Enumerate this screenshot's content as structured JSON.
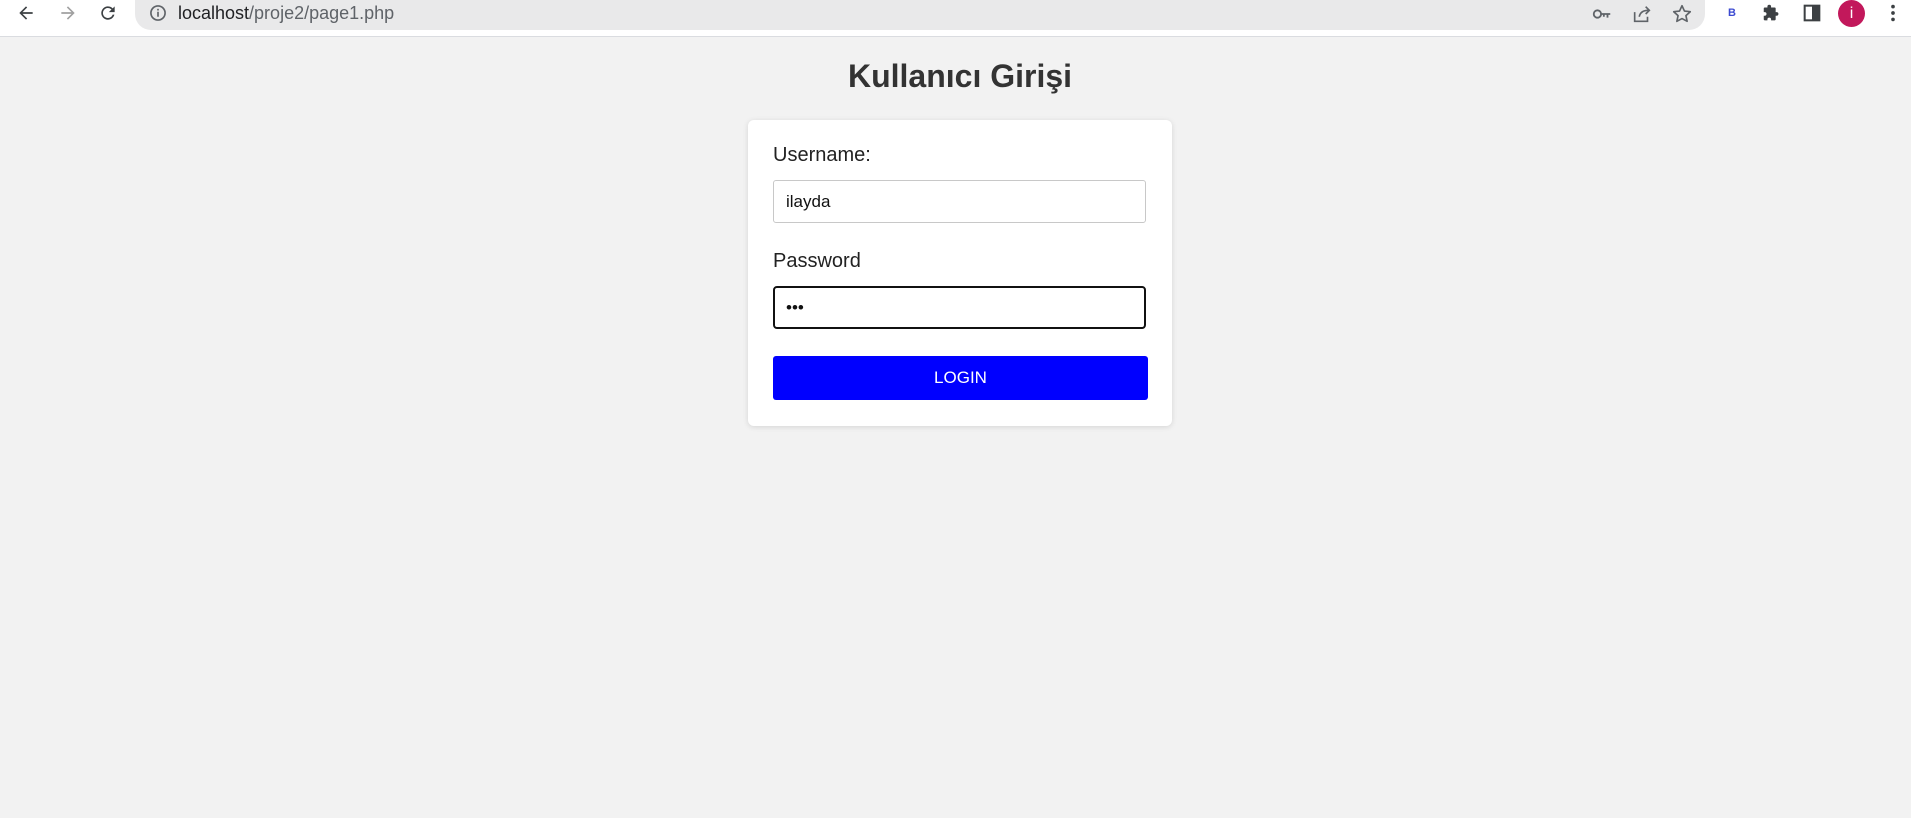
{
  "browser": {
    "url_host": "localhost",
    "url_path": "/proje2/page1.php",
    "extension_label": "B",
    "profile_initial": "i",
    "profile_color": "#c2185b"
  },
  "page": {
    "title": "Kullanıcı Girişi",
    "username_label": "Username:",
    "username_value": "ilayda",
    "password_label": "Password",
    "password_value": "•••",
    "login_label": "LOGIN",
    "login_color": "#0000ff"
  },
  "icons": [
    "back-icon",
    "forward-icon",
    "reload-icon",
    "info-icon",
    "key-icon",
    "share-icon",
    "star-icon",
    "extension-icon",
    "puzzle-icon",
    "side-panel-icon",
    "menu-icon"
  ]
}
